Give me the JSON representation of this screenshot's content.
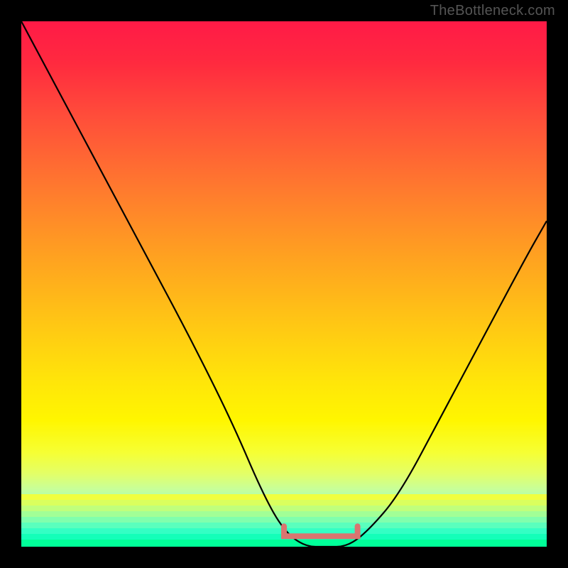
{
  "watermark": "TheBottleneck.com",
  "chart_data": {
    "type": "line",
    "title": "",
    "xlabel": "",
    "ylabel": "",
    "xlim": [
      0,
      100
    ],
    "ylim": [
      0,
      100
    ],
    "grid": false,
    "legend": false,
    "series": [
      {
        "name": "bottleneck-curve",
        "x": [
          0,
          8,
          16,
          24,
          32,
          40,
          46,
          50,
          54,
          58,
          62,
          66,
          72,
          80,
          88,
          96,
          100
        ],
        "values": [
          100,
          85,
          70,
          55,
          40,
          24,
          10,
          3,
          0,
          0,
          0,
          3,
          10,
          25,
          40,
          55,
          62
        ]
      }
    ],
    "annotations": [
      {
        "name": "valley-marker",
        "x_start": 50,
        "x_end": 64,
        "y": 2,
        "color": "#d97570"
      }
    ],
    "background_gradient": {
      "top": "#ff1a47",
      "upper_mid": "#ffa220",
      "mid": "#ffe40a",
      "lower_mid": "#e4ff66",
      "bottom": "#00ff99"
    }
  }
}
